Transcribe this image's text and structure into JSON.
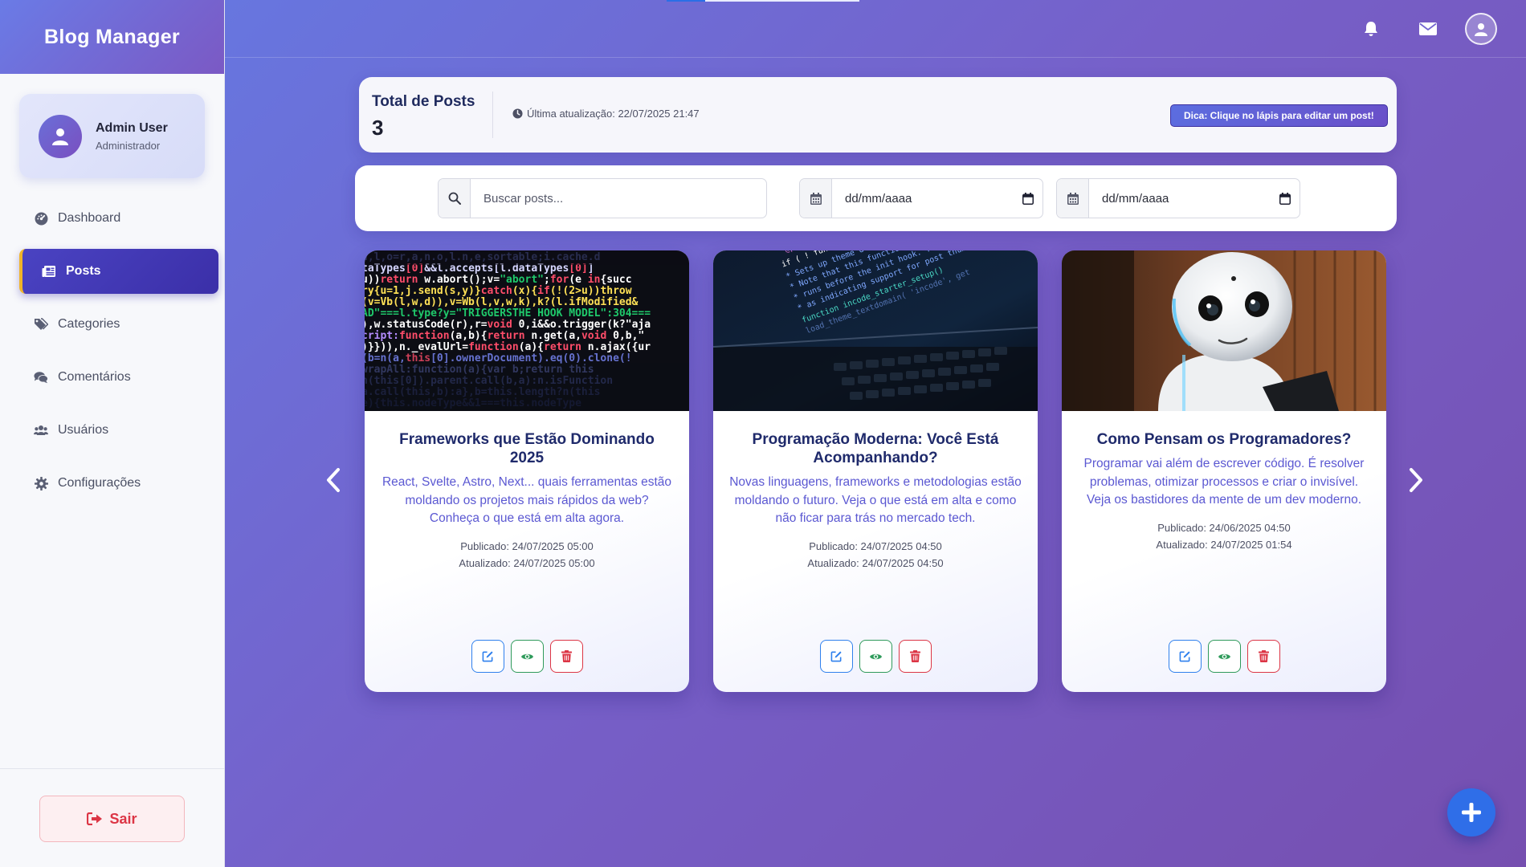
{
  "app": {
    "title": "Blog Manager"
  },
  "profile": {
    "name": "Admin User",
    "role": "Administrador"
  },
  "nav": {
    "items": [
      {
        "label": "Dashboard",
        "icon": "dashboard-icon"
      },
      {
        "label": "Posts",
        "icon": "newspaper-icon",
        "active": true
      },
      {
        "label": "Categories",
        "icon": "tags-icon"
      },
      {
        "label": "Comentários",
        "icon": "comments-icon"
      },
      {
        "label": "Usuários",
        "icon": "users-icon"
      },
      {
        "label": "Configurações",
        "icon": "gear-icon"
      }
    ]
  },
  "logout": {
    "label": "Sair"
  },
  "topbar": {
    "icons": [
      "bell-icon",
      "envelope-icon",
      "user-avatar-icon"
    ]
  },
  "stats": {
    "title": "Total de Posts",
    "count": "3",
    "updated": "Última atualização: 22/07/2025 21:47",
    "tip": "Dica: Clique no lápis para editar um post!"
  },
  "filters": {
    "search_placeholder": "Buscar posts...",
    "date_from": "dd/mm/aaaa",
    "date_to": "dd/mm/aaaa"
  },
  "posts": [
    {
      "title": "Frameworks que Estão Dominando 2025",
      "excerpt": "React, Svelte, Astro, Next... quais ferramentas estão moldando os projetos mais rápidos da web? Conheça o que está em alta agora.",
      "published": "Publicado: 24/07/2025 05:00",
      "updated": "Atualizado: 24/07/2025 05:00"
    },
    {
      "title": "Programação Moderna: Você Está Acompanhando?",
      "excerpt": "Novas linguagens, frameworks e metodologias estão moldando o futuro. Veja o que está em alta e como não ficar para trás no mercado tech.",
      "published": "Publicado: 24/07/2025 04:50",
      "updated": "Atualizado: 24/07/2025 04:50"
    },
    {
      "title": "Como Pensam os Programadores?",
      "excerpt": "Programar vai além de escrever código. É resolver problemas, otimizar processos e criar o invisível. Veja os bastidores da mente de um dev moderno.",
      "published": "Publicado: 24/06/2025 04:50",
      "updated": "Atualizado: 24/07/2025 01:54"
    }
  ],
  "colors": {
    "accent": "#4a43c2",
    "gradient_start": "#6776df",
    "gradient_end": "#764fb0",
    "danger": "#dc3545",
    "success": "#2e9a5a",
    "primary": "#2f80ed"
  }
}
